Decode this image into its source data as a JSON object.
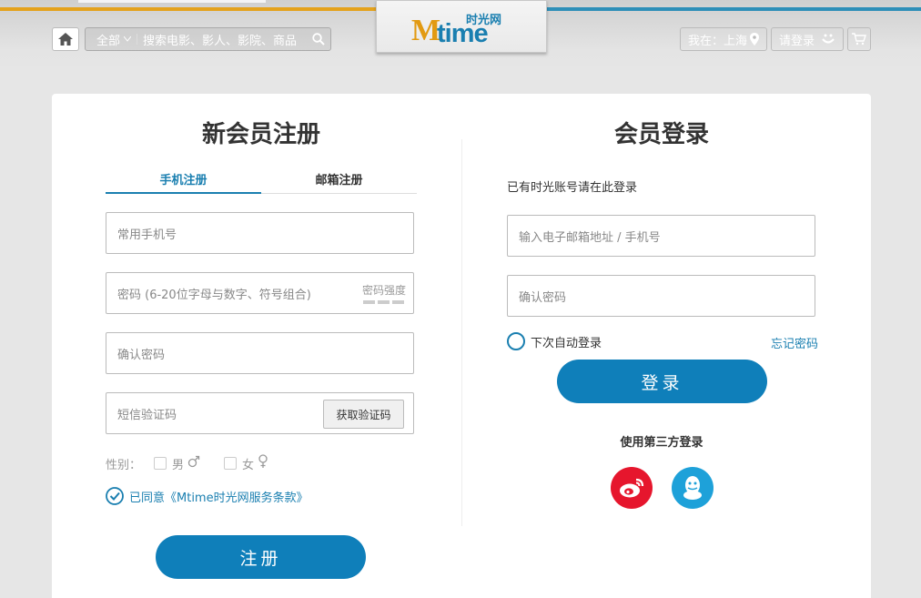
{
  "header": {
    "search_category": "全部",
    "search_placeholder": "搜索电影、影人、影院、商品",
    "logo_brand": "Mtime",
    "logo_cn": "时光网",
    "city_label": "我在：上海",
    "login_label": "请登录"
  },
  "register": {
    "title": "新会员注册",
    "tabs": [
      {
        "label": "手机注册",
        "active": true
      },
      {
        "label": "邮箱注册",
        "active": false
      }
    ],
    "phone_placeholder": "常用手机号",
    "password_placeholder": "密码 (6-20位字母与数字、符号组合)",
    "strength_label": "密码强度",
    "confirm_placeholder": "确认密码",
    "sms_placeholder": "短信验证码",
    "sms_button": "获取验证码",
    "gender_label": "性别：",
    "male": "男",
    "female": "女",
    "agree_text": "已同意《Mtime时光网服务条款》",
    "submit": "注册"
  },
  "login": {
    "title": "会员登录",
    "hint": "已有时光账号请在此登录",
    "account_placeholder": "输入电子邮箱地址 / 手机号",
    "password_placeholder": "确认密码",
    "auto_login": "下次自动登录",
    "forgot": "忘记密码",
    "submit": "登录",
    "third_party_title": "使用第三方登录"
  },
  "colors": {
    "accent": "#0f7fba",
    "logo_orange": "#e29a12",
    "weibo": "#e6162d",
    "qq": "#1ea1d9"
  }
}
